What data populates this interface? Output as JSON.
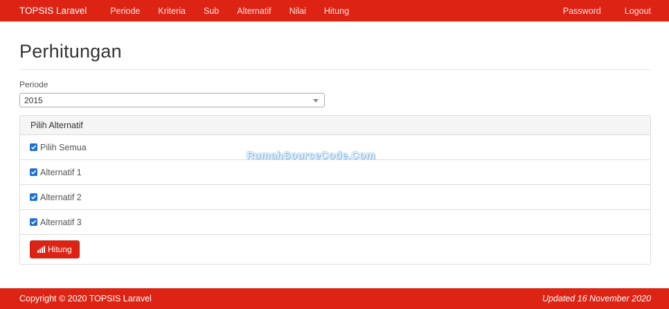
{
  "navbar": {
    "brand": "TOPSIS Laravel",
    "links": [
      "Periode",
      "Kriteria",
      "Sub",
      "Alternatif",
      "Nilai",
      "Hitung"
    ],
    "right_links": [
      "Password",
      "Logout"
    ],
    "color": "#dd2414"
  },
  "page": {
    "title": "Perhitungan",
    "periode_label": "Periode",
    "periode_value": "2015"
  },
  "panel": {
    "heading": "Pilih Alternatif",
    "items": [
      {
        "label": "Pilih Semua",
        "checked": true
      },
      {
        "label": "Alternatif 1",
        "checked": true
      },
      {
        "label": "Alternatif 2",
        "checked": true
      },
      {
        "label": "Alternatif 3",
        "checked": true
      }
    ],
    "button_label": "Hitung",
    "button_icon": "bar-chart-icon"
  },
  "watermark": "RumahSourceCode.Com",
  "footer": {
    "copyright": "Copyright © 2020 TOPSIS Laravel",
    "updated": "Updated 16 November 2020"
  }
}
